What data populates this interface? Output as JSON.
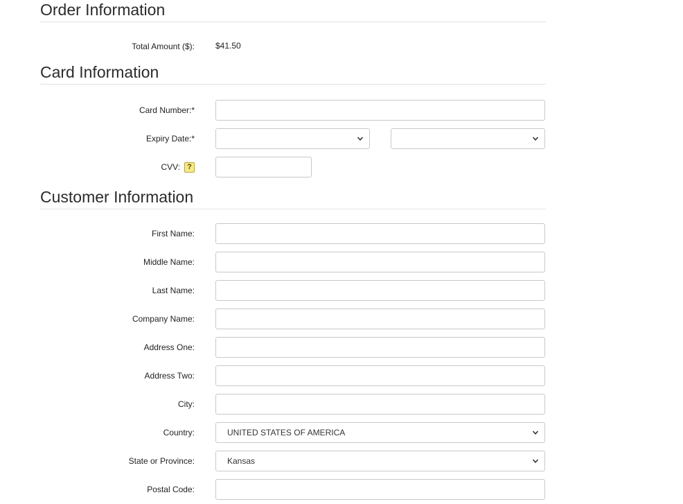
{
  "order": {
    "title": "Order Information",
    "total_label": "Total Amount ($):",
    "total_value": "$41.50"
  },
  "card": {
    "title": "Card Information",
    "number_label": "Card Number:*",
    "number_value": "",
    "expiry_label": "Expiry Date:*",
    "expiry_month": "",
    "expiry_year": "",
    "cvv_label": "CVV:",
    "cvv_help": "?",
    "cvv_value": ""
  },
  "customer": {
    "title": "Customer Information",
    "first_name_label": "First Name:",
    "middle_name_label": "Middle Name:",
    "last_name_label": "Last Name:",
    "company_label": "Company Name:",
    "address_one_label": "Address One:",
    "address_two_label": "Address Two:",
    "city_label": "City:",
    "country_label": "Country:",
    "country_value": "UNITED STATES OF AMERICA",
    "state_label": "State or Province:",
    "state_value": "Kansas",
    "postal_label": "Postal Code:"
  },
  "icons": {
    "chevron": "chevron-down-icon",
    "help": "help-icon"
  }
}
